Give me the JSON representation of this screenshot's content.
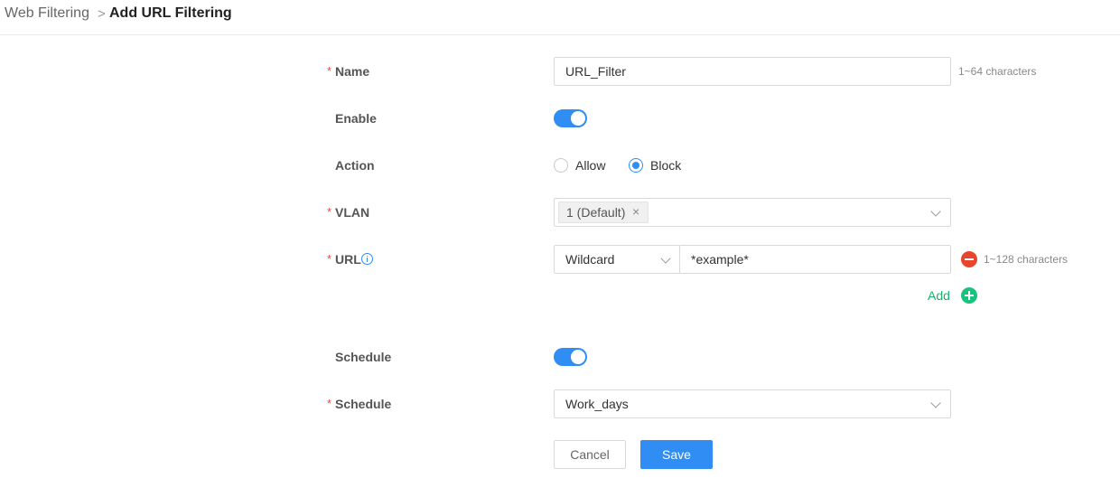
{
  "breadcrumb": {
    "parent": "Web Filtering",
    "separator": ">",
    "current": "Add URL Filtering"
  },
  "form": {
    "required_mark": "*",
    "name": {
      "label": "Name",
      "value": "URL_Filter",
      "hint": "1~64 characters"
    },
    "enable": {
      "label": "Enable",
      "on": true
    },
    "action": {
      "label": "Action",
      "options": [
        "Allow",
        "Block"
      ],
      "selected": "Block"
    },
    "vlan": {
      "label": "VLAN",
      "tag": "1 (Default)",
      "tag_remove": "×"
    },
    "url": {
      "label": "URL",
      "match_type": "Wildcard",
      "value": "*example*",
      "hint": "1~128 characters",
      "add_label": "Add"
    },
    "schedule_toggle": {
      "label": "Schedule",
      "on": true
    },
    "schedule_select": {
      "label": "Schedule",
      "value": "Work_days"
    }
  },
  "buttons": {
    "cancel": "Cancel",
    "save": "Save"
  },
  "colors": {
    "accent": "#2f8df4",
    "required": "#e74c3c",
    "add": "#19c37d",
    "remove": "#e8452c"
  },
  "icons": [
    "chevron-right-icon",
    "info-icon",
    "close-icon",
    "chevron-down-icon",
    "minus-circle-icon",
    "plus-circle-icon"
  ]
}
